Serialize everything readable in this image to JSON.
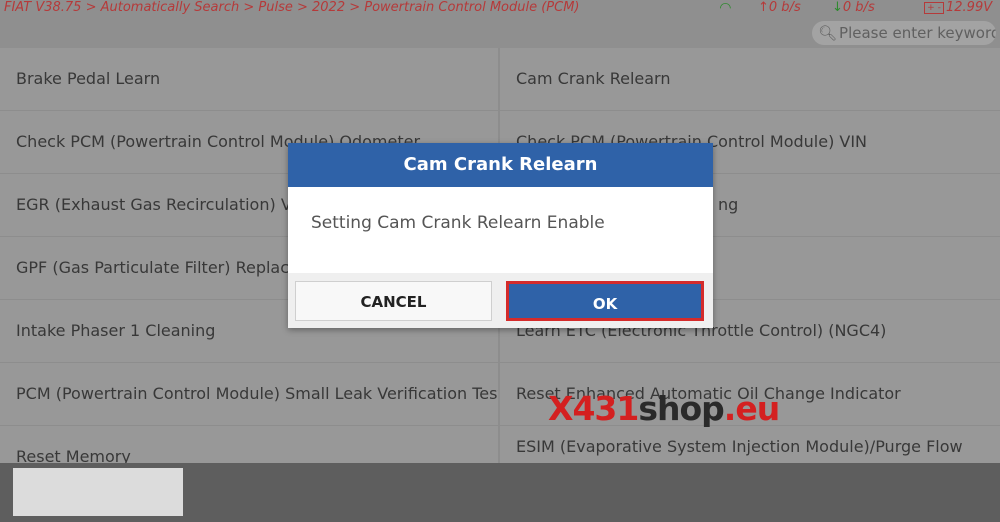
{
  "status_bar": {
    "breadcrumb": "FIAT V38.75 > Automatically Search > Pulse > 2022 > Powertrain Control Module (PCM)",
    "upload_rate": "0 b/s",
    "download_rate": "0 b/s",
    "voltage": "12.99V",
    "icons": {
      "wifi": "wifi-icon",
      "upload": "arrow-up-icon",
      "download": "arrow-down-icon",
      "battery": "battery-icon"
    }
  },
  "search": {
    "placeholder": "Please enter keyword",
    "icon": "search-icon"
  },
  "functions": {
    "left": [
      "Brake Pedal Learn",
      "Check PCM (Powertrain Control Module) Odometer",
      "EGR (Exhaust Gas Recirculation) Val",
      "GPF (Gas Particulate Filter) Replace",
      "Intake Phaser 1 Cleaning",
      "PCM (Powertrain Control Module) Small Leak Verification Test",
      "Reset Memory"
    ],
    "right": [
      "Cam Crank Relearn",
      "Check PCM (Powertrain Control Module) VIN",
      "ng",
      "",
      "Learn ETC (Electronic Throttle Control) (NGC4)",
      "Reset Enhanced Automatic Oil Change Indicator",
      "ESIM (Evaporative System Injection Module)/Purge Flow"
    ]
  },
  "dialog": {
    "title": "Cam Crank Relearn",
    "message": "Setting Cam Crank Relearn Enable",
    "cancel_label": "CANCEL",
    "ok_label": "OK",
    "colors": {
      "header": "#2f62a8",
      "ok_border": "#d42b2b"
    }
  },
  "watermark": {
    "x": "X",
    "num": "431",
    "shop": "shop",
    "eu": ".eu"
  }
}
